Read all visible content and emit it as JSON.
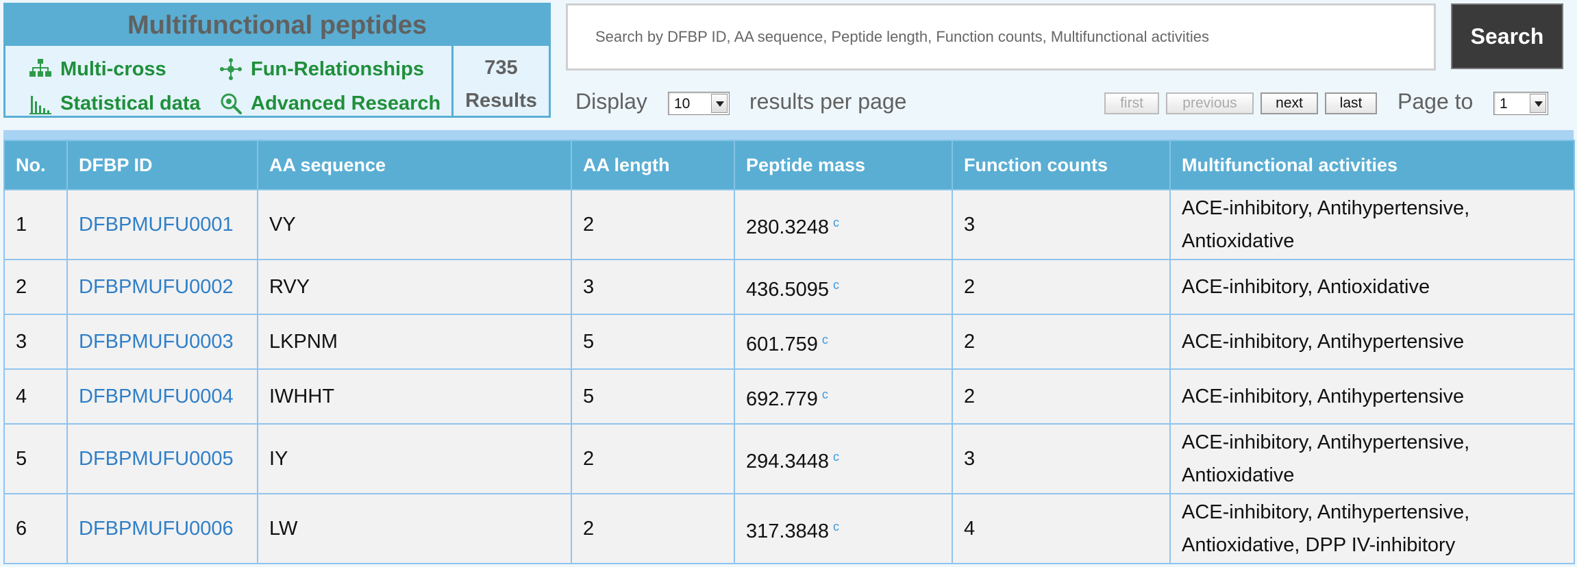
{
  "panel": {
    "title": "Multifunctional peptides",
    "links": {
      "multi_cross": "Multi-cross",
      "fun_relationships": "Fun-Relationships",
      "statistical_data": "Statistical data",
      "advanced_research": "Advanced Research"
    },
    "results_count": "735",
    "results_label": "Results"
  },
  "search": {
    "placeholder": "Search by DFBP ID, AA sequence, Peptide length, Function counts, Multifunctional activities",
    "button_label": "Search"
  },
  "display": {
    "label": "Display",
    "selected": "10",
    "suffix": "results per page"
  },
  "pager": {
    "first": "first",
    "previous": "previous",
    "next": "next",
    "last": "last",
    "page_to_label": "Page to",
    "page_selected": "1"
  },
  "table": {
    "headers": {
      "no": "No.",
      "id": "DFBP ID",
      "seq": "AA sequence",
      "len": "AA length",
      "mass": "Peptide mass",
      "count": "Function counts",
      "activities": "Multifunctional activities"
    },
    "calc_mark": "c",
    "rows": [
      {
        "no": "1",
        "id": "DFBPMUFU0001",
        "seq": "VY",
        "len": "2",
        "mass": "280.3248",
        "count": "3",
        "activities": "ACE-inhibitory, Antihypertensive, Antioxidative"
      },
      {
        "no": "2",
        "id": "DFBPMUFU0002",
        "seq": "RVY",
        "len": "3",
        "mass": "436.5095",
        "count": "2",
        "activities": "ACE-inhibitory, Antioxidative"
      },
      {
        "no": "3",
        "id": "DFBPMUFU0003",
        "seq": "LKPNM",
        "len": "5",
        "mass": "601.759",
        "count": "2",
        "activities": "ACE-inhibitory, Antihypertensive"
      },
      {
        "no": "4",
        "id": "DFBPMUFU0004",
        "seq": "IWHHT",
        "len": "5",
        "mass": "692.779",
        "count": "2",
        "activities": "ACE-inhibitory, Antihypertensive"
      },
      {
        "no": "5",
        "id": "DFBPMUFU0005",
        "seq": "IY",
        "len": "2",
        "mass": "294.3448",
        "count": "3",
        "activities": "ACE-inhibitory, Antihypertensive, Antioxidative"
      },
      {
        "no": "6",
        "id": "DFBPMUFU0006",
        "seq": "LW",
        "len": "2",
        "mass": "317.3848",
        "count": "4",
        "activities": "ACE-inhibitory, Antihypertensive, Antioxidative, DPP IV-inhibitory"
      }
    ]
  },
  "colors": {
    "header_blue": "#5aaed3",
    "link_green": "#1f8f3a",
    "id_link_blue": "#2f7fc8",
    "search_button": "#3a3a3a"
  },
  "icons": [
    "hierarchy-icon",
    "network-icon",
    "bar-chart-icon",
    "magnifier-icon",
    "chevron-down-icon"
  ]
}
